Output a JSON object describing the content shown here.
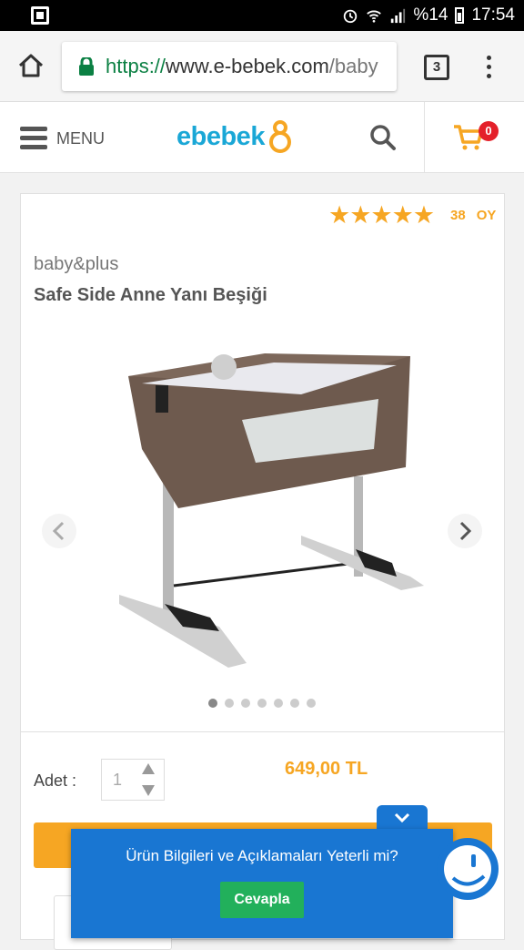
{
  "status_bar": {
    "battery_percent": "%14",
    "time": "17:54"
  },
  "browser": {
    "url_scheme": "https://",
    "url_host": "www.e-bebek.com",
    "url_path": "/baby",
    "tab_count": "3"
  },
  "header": {
    "menu_label": "MENU",
    "logo_text": "ebebek",
    "cart_count": "0"
  },
  "product": {
    "rating_stars": "★★★★★",
    "rating_value": 5,
    "rating_count": "38",
    "rating_label": "OY",
    "brand": "baby&plus",
    "title": "Safe Side Anne Yanı Beşiği",
    "image_count": 7,
    "active_image_index": 0,
    "quantity_label": "Adet :",
    "quantity_value": "1",
    "price": "649,00 TL"
  },
  "survey": {
    "question": "Ürün Bilgileri ve Açıklamaları Yeterli mi?",
    "answer_button": "Cevapla"
  },
  "colors": {
    "accent_orange": "#f6a623",
    "brand_blue": "#1aa7d6",
    "survey_blue": "#1976d2",
    "answer_green": "#22b05b",
    "badge_red": "#e4202a"
  }
}
